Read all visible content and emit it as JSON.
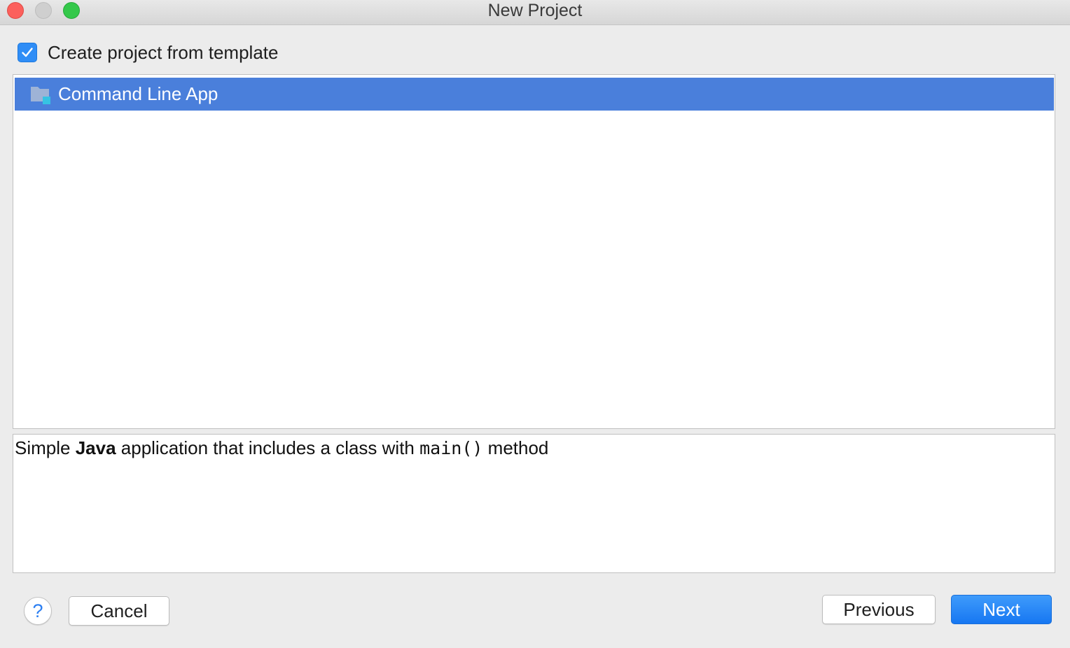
{
  "window": {
    "title": "New Project"
  },
  "template_checkbox": {
    "label": "Create project from template",
    "checked": true
  },
  "template_list": {
    "items": [
      {
        "label": "Command Line App",
        "icon": "folder-icon",
        "selected": true
      }
    ]
  },
  "description": {
    "part1": "Simple ",
    "part2_bold": "Java",
    "part3": " application that includes a class with ",
    "part4_code": "main()",
    "part5": " method"
  },
  "buttons": {
    "help": "?",
    "cancel": "Cancel",
    "previous": "Previous",
    "next": "Next"
  },
  "colors": {
    "selection": "#4a7fdb",
    "accent": "#2f8df6",
    "close": "#fc605c",
    "zoom": "#34c84a"
  }
}
